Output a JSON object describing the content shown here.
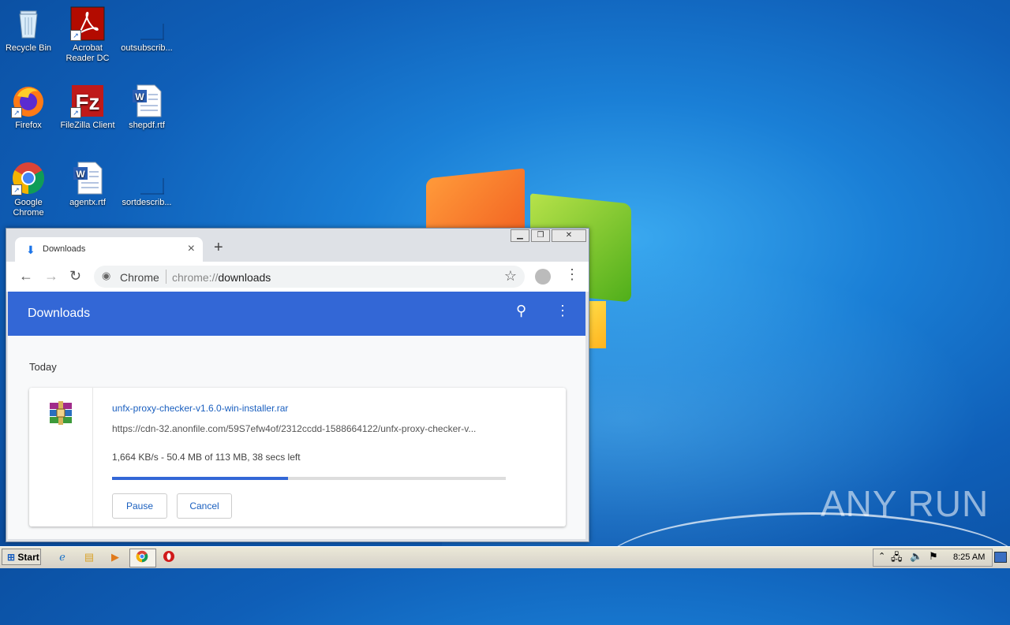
{
  "desktop": {
    "icons": [
      {
        "label": "Recycle Bin"
      },
      {
        "label": "Acrobat Reader DC"
      },
      {
        "label": "outsubscrib..."
      },
      {
        "label": "Firefox"
      },
      {
        "label": "FileZilla Client"
      },
      {
        "label": "shepdf.rtf"
      },
      {
        "label": "Google Chrome"
      },
      {
        "label": "agentx.rtf"
      },
      {
        "label": "sortdescrib..."
      }
    ]
  },
  "browser": {
    "tab_title": "Downloads",
    "omnibox_label": "Chrome",
    "url_scheme": "chrome://",
    "url_path": "downloads",
    "header_title": "Downloads",
    "section_label": "Today",
    "download": {
      "filename": "unfx-proxy-checker-v1.6.0-win-installer.rar",
      "url": "https://cdn-32.anonfile.com/59S7efw4of/2312ccdd-1588664122/unfx-proxy-checker-v...",
      "status": "1,664 KB/s - 50.4 MB of 113 MB, 38 secs left",
      "progress_fraction": 0.446,
      "pause_label": "Pause",
      "cancel_label": "Cancel"
    }
  },
  "taskbar": {
    "start_label": "Start",
    "clock": "8:25 AM"
  },
  "watermark": "ANY RUN",
  "colors": {
    "accent": "#3367d6",
    "link": "#1a5fbf"
  }
}
